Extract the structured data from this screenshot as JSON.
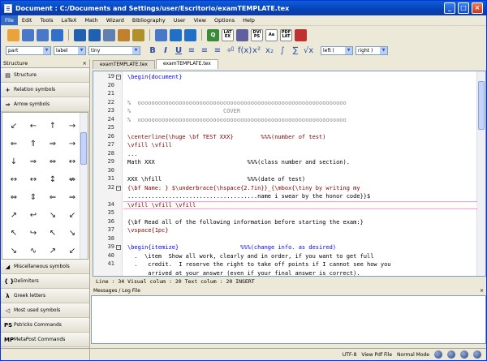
{
  "window": {
    "title": "Document : C:/Documents and Settings/user/Escritorio/examTEMPLATE.tex"
  },
  "menu": [
    "File",
    "Edit",
    "Tools",
    "LaTeX",
    "Math",
    "Wizard",
    "Bibliography",
    "User",
    "View",
    "Options",
    "Help"
  ],
  "toolbar": [
    {
      "icon": "new-file-icon",
      "c": "#e8a33a"
    },
    {
      "icon": "save-icon",
      "c": "#4a78c8"
    },
    {
      "icon": "save-all-icon",
      "c": "#4a78c8"
    },
    {
      "icon": "close-doc-icon",
      "c": "#3070c8"
    },
    {
      "sep": 1
    },
    {
      "icon": "undo-icon",
      "c": "#2060b0"
    },
    {
      "icon": "redo-icon",
      "c": "#2060b0"
    },
    {
      "icon": "copy-icon",
      "c": "#6080b0"
    },
    {
      "icon": "cut-icon",
      "c": "#c08030"
    },
    {
      "icon": "paste-icon",
      "c": "#b0902a"
    },
    {
      "sep": 1
    },
    {
      "icon": "structure-view-icon",
      "c": "#4a78c8"
    },
    {
      "icon": "back-icon",
      "c": "#2070c8"
    },
    {
      "icon": "forward-icon",
      "c": "#2070c8"
    },
    {
      "sep": 1
    },
    {
      "icon": "quick-build-icon",
      "c": "#3a8a3a",
      "t": "Q"
    },
    {
      "icon": "latex-icon",
      "t": "LAT EX"
    },
    {
      "icon": "view-dvi-icon",
      "c": "#6060a0"
    },
    {
      "icon": "dvi-ps-icon",
      "t": "DVI PS"
    },
    {
      "icon": "view-ps-icon",
      "t": "Aa"
    },
    {
      "icon": "pdflatex-icon",
      "t": "PDF LAT"
    },
    {
      "icon": "view-pdf-icon",
      "c": "#c03030"
    }
  ],
  "format": {
    "section": "part",
    "reference": "label",
    "size": "tiny",
    "left_delim": "left (",
    "right_delim": "right )",
    "fmt_buttons": [
      "B",
      "I",
      "U",
      "≡",
      "≡",
      "≡",
      "⏎",
      "f(x)",
      "x²",
      "x₂",
      "∫",
      "∑",
      "√x"
    ]
  },
  "sidebar": {
    "title": "Structure",
    "close": "×",
    "top_buttons": [
      {
        "label": "Structure",
        "icon": "▤"
      },
      {
        "label": "Relation symbols",
        "icon": "+"
      },
      {
        "label": "Arrow symbols",
        "icon": "⇒"
      }
    ],
    "symbols": [
      "↙",
      "←",
      "↑",
      "→",
      "⇐",
      "⇑",
      "⇒",
      "→",
      "↓",
      "⇒",
      "⇔",
      "↔",
      "↔",
      "↔",
      "↕",
      "⇎",
      "⇔",
      "⇕",
      "⇐",
      "⇒",
      "↗",
      "↩",
      "↘",
      "↙",
      "↖",
      "↪",
      "↖",
      "↘",
      "↘",
      "∿",
      "↗",
      "↙"
    ],
    "bottom_buttons": [
      {
        "label": "Miscellaneous symbols",
        "icon": "◢"
      },
      {
        "label": "Delimiters",
        "icon": "{ }"
      },
      {
        "label": "Greek letters",
        "icon": "λ"
      },
      {
        "label": "Most used symbols",
        "icon": "◁"
      },
      {
        "label": "Pstricks Commands",
        "icon": "PS"
      },
      {
        "label": "MetaPost Commands",
        "icon": "MP"
      }
    ]
  },
  "tabs": [
    "examTEMPLATE.tex",
    "examTEMPLATE.tex"
  ],
  "code": [
    {
      "n": "19",
      "fold": "−",
      "t": "\\begin{document}",
      "k": "kw"
    },
    {
      "n": "20",
      "t": ""
    },
    {
      "n": "21",
      "t": ""
    },
    {
      "n": "22",
      "t": "%  ooooooooooooooooooooooooooooooooooooooooooooooooooooooooooooo",
      "k": "cm"
    },
    {
      "n": "23",
      "t": "%                           COVER",
      "k": "cm"
    },
    {
      "n": "24",
      "t": "%  ooooooooooooooooooooooooooooooooooooooooooooooooooooooooooooo",
      "k": "cm"
    },
    {
      "n": "25",
      "t": ""
    },
    {
      "n": "26",
      "t": "\\centerline{\\huge \\bf TEST XXX}        %%%(number of test)",
      "k": "cmd"
    },
    {
      "n": "27",
      "t": "\\vfill \\vfill",
      "k": "cmd"
    },
    {
      "n": "28",
      "t": "..."
    },
    {
      "n": "29",
      "t": "Math XXX                           %%%(class number and section)."
    },
    {
      "n": "30",
      "t": ""
    },
    {
      "n": "31",
      "t": "XXX \\hfill                         %%%(date of test)"
    },
    {
      "n": "32",
      "fold": "−",
      "t": "{\\bf Name: } $\\underbrace{\\hspace{2.7in}}_{\\mbox{\\tiny by writing my",
      "k": "cmd"
    },
    {
      "n": "",
      "t": "......................................name i swear by the honor code}}$"
    },
    {
      "n": "34",
      "t": "\\vfill \\vfill \\vfill",
      "k": "cmd",
      "cur": 1
    },
    {
      "n": "35",
      "t": ""
    },
    {
      "n": "36",
      "t": "{\\bf Read all of the following information before starting the exam:}"
    },
    {
      "n": "37",
      "t": "\\vspace{1pc}",
      "k": "cmd"
    },
    {
      "n": "38",
      "t": ""
    },
    {
      "n": "39",
      "fold": "−",
      "t": "\\begin{itemize}                  %%%(change info. as desired)",
      "k": "kw"
    },
    {
      "n": "40",
      "t": "  .  \\item  Show all work, clearly and in order, if you want to get full"
    },
    {
      "n": "41",
      "t": "  .   credit.  I reserve the right to take off points if I cannot see how you"
    },
    {
      "n": "",
      "t": "      arrived at your answer (even if your final answer is correct)."
    }
  ],
  "status_line": "Line : 34 Visual colum : 20 Text colum : 20  INSERT",
  "log": {
    "title": "Messages / Log File",
    "close": "×"
  },
  "status": {
    "encoding": "UTF-8",
    "view": "View Pdf File",
    "mode": "Normal Mode"
  }
}
